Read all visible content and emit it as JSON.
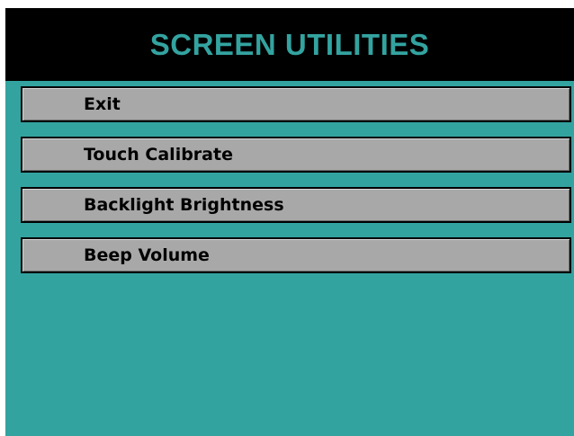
{
  "screen": {
    "title": "SCREEN UTILITIES",
    "colors": {
      "background": "#33a3a0",
      "title_bar": "#000000",
      "title_text": "#33a3a0",
      "button_face": "#a8a8a8",
      "button_text": "#000000"
    }
  },
  "menu": {
    "items": [
      {
        "label": "Exit"
      },
      {
        "label": "Touch Calibrate"
      },
      {
        "label": "Backlight Brightness"
      },
      {
        "label": "Beep Volume"
      }
    ]
  }
}
